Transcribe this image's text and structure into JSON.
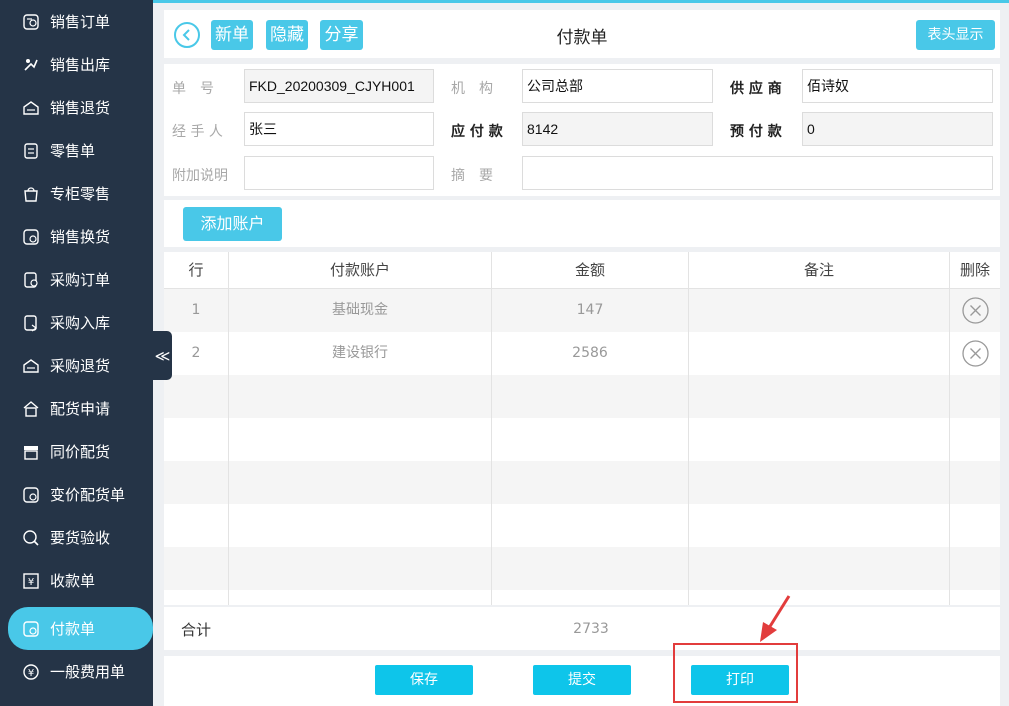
{
  "sidebar": {
    "items": [
      {
        "label": "销售订单",
        "icon": "sales-order-icon"
      },
      {
        "label": "销售出库",
        "icon": "sales-outbound-icon"
      },
      {
        "label": "销售退货",
        "icon": "sales-return-icon"
      },
      {
        "label": "零售单",
        "icon": "retail-order-icon"
      },
      {
        "label": "专柜零售",
        "icon": "counter-retail-icon"
      },
      {
        "label": "销售换货",
        "icon": "sales-exchange-icon"
      },
      {
        "label": "采购订单",
        "icon": "purchase-order-icon"
      },
      {
        "label": "采购入库",
        "icon": "purchase-inbound-icon"
      },
      {
        "label": "采购退货",
        "icon": "purchase-return-icon"
      },
      {
        "label": "配货申请",
        "icon": "distribution-request-icon"
      },
      {
        "label": "同价配货",
        "icon": "same-price-distribution-icon"
      },
      {
        "label": "变价配货单",
        "icon": "variable-price-distribution-icon"
      },
      {
        "label": "要货验收",
        "icon": "goods-acceptance-icon"
      },
      {
        "label": "收款单",
        "icon": "receipt-icon"
      },
      {
        "label": "付款单",
        "icon": "payment-icon",
        "active": true
      },
      {
        "label": "一般费用单",
        "icon": "expense-icon"
      }
    ],
    "collapse_glyph": "≪"
  },
  "header": {
    "new_label": "新单",
    "hide_label": "隐藏",
    "share_label": "分享",
    "title": "付款单",
    "header_display_label": "表头显示"
  },
  "form": {
    "order_no_label": "单　号",
    "order_no_value": "FKD_20200309_CJYH001",
    "org_label": "机　构",
    "org_value": "公司总部",
    "supplier_label": "供 应 商",
    "supplier_value": "佰诗奴",
    "handler_label": "经 手 人",
    "handler_value": "张三",
    "payable_label": "应 付 款",
    "payable_value": "8142",
    "prepaid_label": "预 付 款",
    "prepaid_value": "0",
    "note_label": "附加说明",
    "note_value": "",
    "summary_label": "摘　要",
    "summary_value": ""
  },
  "add_account_label": "添加账户",
  "table": {
    "headers": {
      "row": "行",
      "account": "付款账户",
      "amount": "金额",
      "remark": "备注",
      "delete": "删除"
    },
    "rows": [
      {
        "no": "1",
        "account": "基础现金",
        "amount": "147",
        "remark": ""
      },
      {
        "no": "2",
        "account": "建设银行",
        "amount": "2586",
        "remark": ""
      }
    ]
  },
  "total": {
    "label": "合计",
    "value": "2733"
  },
  "actions": {
    "save": "保存",
    "submit": "提交",
    "print": "打印"
  },
  "colors": {
    "accent": "#49c8e8",
    "sidebar_bg": "#253447",
    "highlight": "#e23c3c"
  }
}
